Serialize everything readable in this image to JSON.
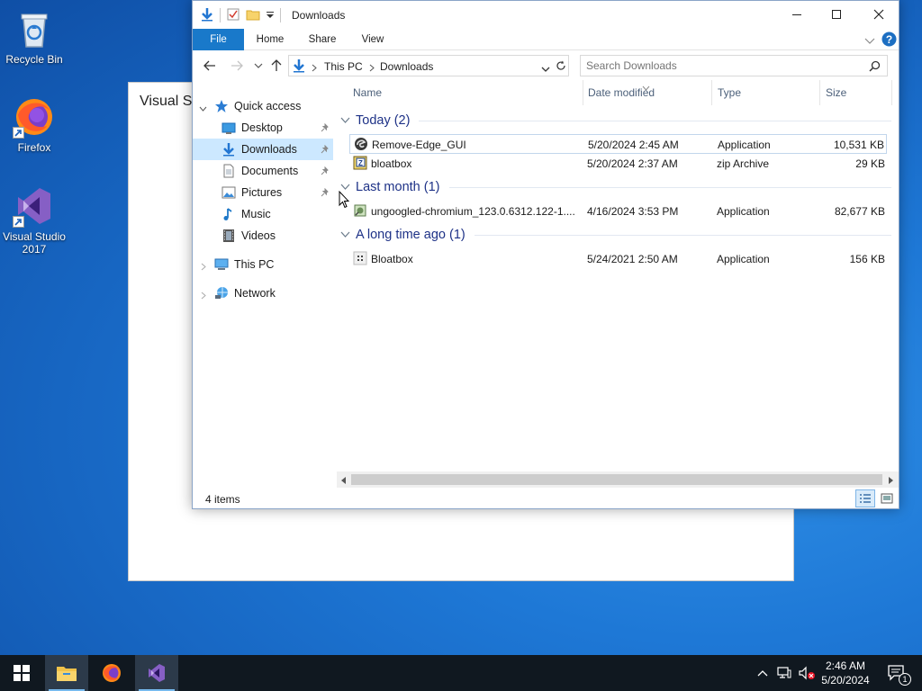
{
  "desktop": {
    "icons": [
      {
        "label": "Recycle Bin"
      },
      {
        "label": "Firefox"
      },
      {
        "label": "Visual Studio 2017"
      }
    ]
  },
  "background_window": {
    "title": "Visual St"
  },
  "explorer": {
    "title": "Downloads",
    "ribbon_tabs": [
      "File",
      "Home",
      "Share",
      "View"
    ],
    "address": {
      "crumbs": [
        "This PC",
        "Downloads"
      ]
    },
    "search": {
      "placeholder": "Search Downloads"
    },
    "nav": {
      "quick_access": "Quick access",
      "items": [
        "Desktop",
        "Downloads",
        "Documents",
        "Pictures",
        "Music",
        "Videos"
      ],
      "this_pc": "This PC",
      "network": "Network"
    },
    "columns": [
      "Name",
      "Date modified",
      "Type",
      "Size"
    ],
    "groups": [
      {
        "label": "Today (2)",
        "files": [
          {
            "name": "Remove-Edge_GUI",
            "date": "5/20/2024 2:45 AM",
            "type": "Application",
            "size": "10,531 KB"
          },
          {
            "name": "bloatbox",
            "date": "5/20/2024 2:37 AM",
            "type": "zip Archive",
            "size": "29 KB"
          }
        ]
      },
      {
        "label": "Last month (1)",
        "files": [
          {
            "name": "ungoogled-chromium_123.0.6312.122-1....",
            "date": "4/16/2024 3:53 PM",
            "type": "Application",
            "size": "82,677 KB"
          }
        ]
      },
      {
        "label": "A long time ago (1)",
        "files": [
          {
            "name": "Bloatbox",
            "date": "5/24/2021 2:50 AM",
            "type": "Application",
            "size": "156 KB"
          }
        ]
      }
    ],
    "status": "4 items"
  },
  "taskbar": {
    "clock_time": "2:46 AM",
    "clock_date": "5/20/2024",
    "notification_count": "1"
  },
  "colors": {
    "accent": "#1979ca",
    "selection": "#cce8ff",
    "group_header": "#1e3287",
    "taskbar": "#101820"
  }
}
